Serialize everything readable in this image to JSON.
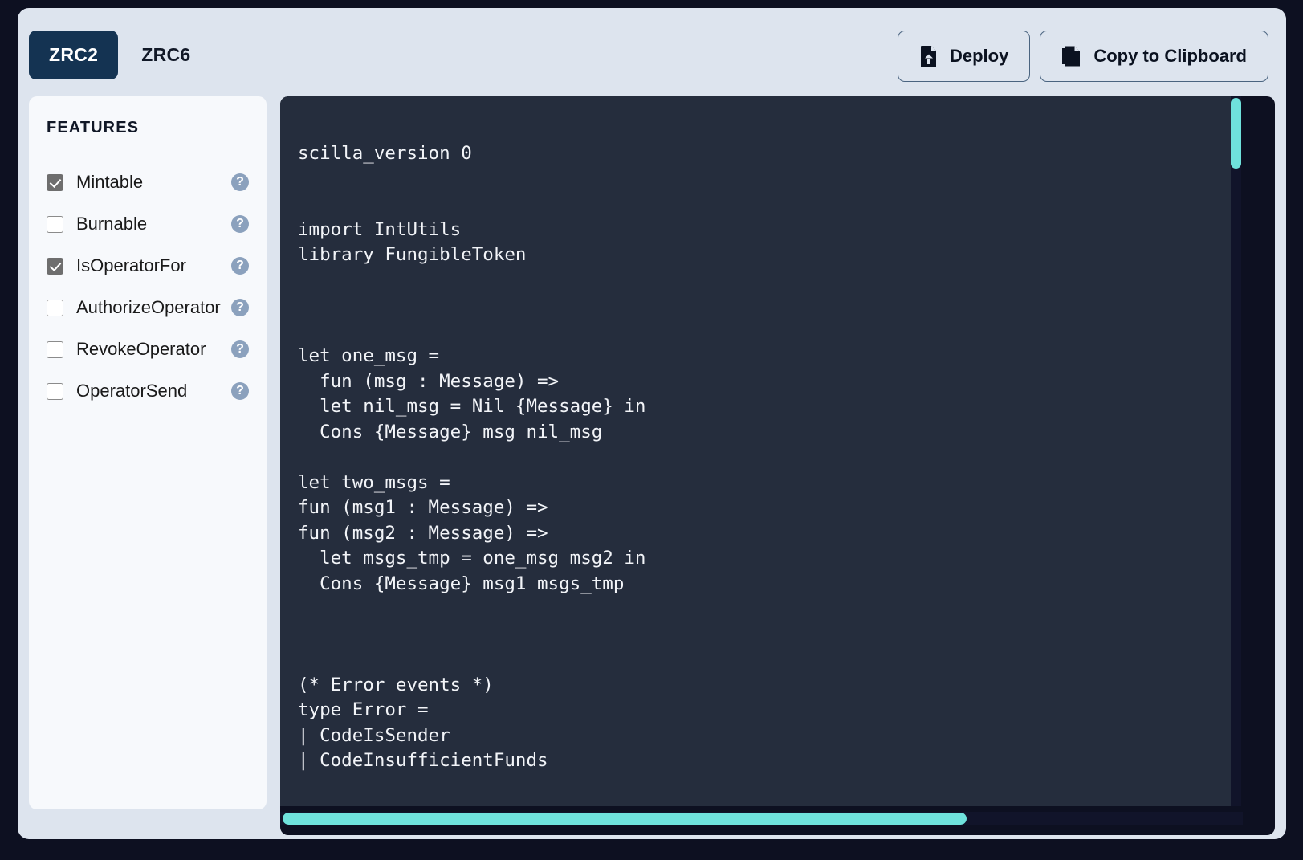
{
  "tabs": [
    {
      "label": "ZRC2",
      "active": true
    },
    {
      "label": "ZRC6",
      "active": false
    }
  ],
  "toolbar": {
    "deploy_label": "Deploy",
    "deploy_icon": "file-upload-icon",
    "copy_label": "Copy to Clipboard",
    "copy_icon": "copy-icon"
  },
  "sidebar": {
    "title": "FEATURES",
    "help_glyph": "?",
    "items": [
      {
        "label": "Mintable",
        "checked": true
      },
      {
        "label": "Burnable",
        "checked": false
      },
      {
        "label": "IsOperatorFor",
        "checked": true
      },
      {
        "label": "AuthorizeOperator",
        "checked": false
      },
      {
        "label": "RevokeOperator",
        "checked": false
      },
      {
        "label": "OperatorSend",
        "checked": false
      }
    ]
  },
  "editor": {
    "language": "scilla",
    "code": "scilla_version 0\n\n\nimport IntUtils\nlibrary FungibleToken\n\n\n\nlet one_msg = \n  fun (msg : Message) => \n  let nil_msg = Nil {Message} in\n  Cons {Message} msg nil_msg\n\nlet two_msgs =\nfun (msg1 : Message) =>\nfun (msg2 : Message) =>\n  let msgs_tmp = one_msg msg2 in\n  Cons {Message} msg1 msgs_tmp\n\n\n\n(* Error events *)\ntype Error =\n| CodeIsSender\n| CodeInsufficientFunds"
  },
  "scrollbars": {
    "vertical_thumb_color": "#6fe2dc",
    "horizontal_thumb_color": "#6fe2dc",
    "track_color": "#11142a"
  },
  "colors": {
    "page_background": "#0d1021",
    "card_background": "#dde4ee",
    "panel_background": "#f7f9fc",
    "active_tab_background": "#143352",
    "editor_background": "#252d3d",
    "accent": "#6fe2dc"
  }
}
